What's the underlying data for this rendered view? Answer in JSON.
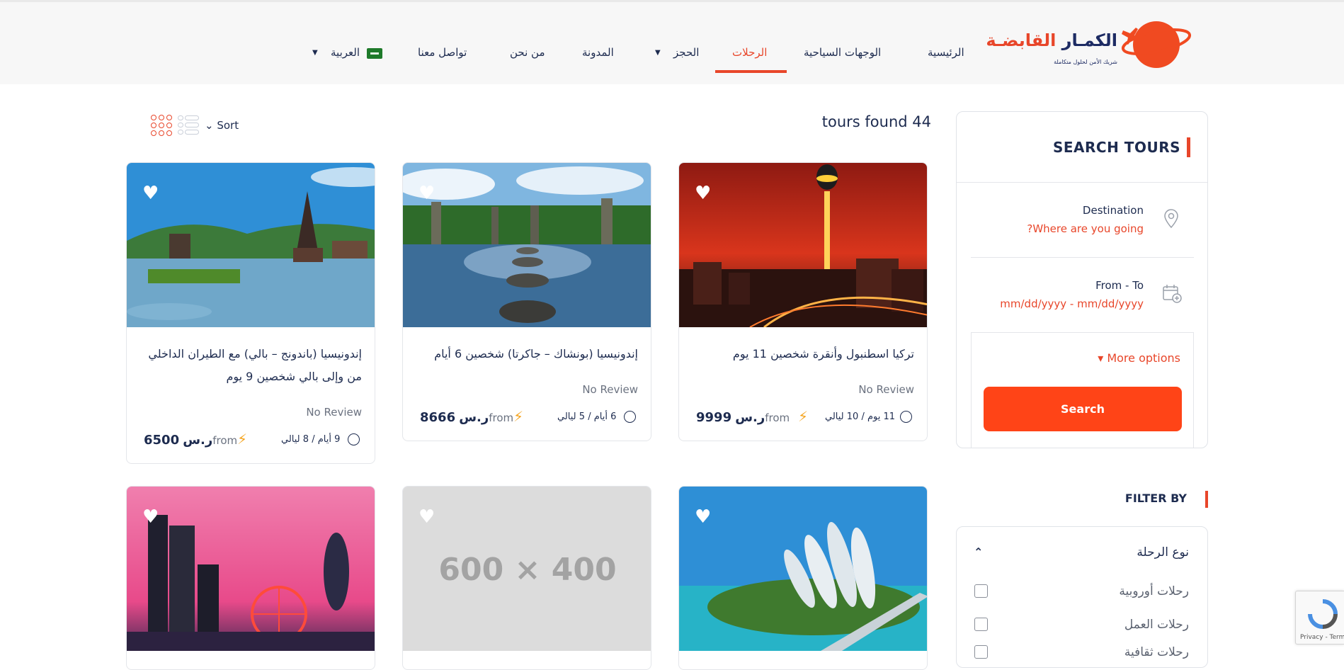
{
  "header": {
    "logo": {
      "name_navy": "الكمـار",
      "name_orange": "القابضـة",
      "tagline": "شريك الأمن لحلول متكاملة"
    },
    "nav": [
      {
        "label": "الرئيسية"
      },
      {
        "label": "الوجهات السياحية"
      },
      {
        "label": "الرحلات"
      },
      {
        "label": "الحجز"
      },
      {
        "label": "المدونة"
      },
      {
        "label": "من نحن"
      },
      {
        "label": "تواصل معنا"
      },
      {
        "label": "العربية"
      }
    ],
    "active_nav": "الرحلات"
  },
  "results": {
    "count_text": "tours found 44",
    "sort_label": "Sort"
  },
  "tours": [
    {
      "title": "تركيا اسطنبول وأنقرة شخصين 11 يوم",
      "review": "No Review",
      "duration": "11 يوم / 10 ليالي",
      "from": "from",
      "price": "9999",
      "currency": "ر.س",
      "image": "istanbul-night"
    },
    {
      "title": "إندونيسيا (بونشاك – جاكرتا) شخصين 6 أيام",
      "review": "No Review",
      "duration": "6 أيام / 5 ليالي",
      "from": "from",
      "price": "8666",
      "currency": "ر.س",
      "image": "bali-water-temple"
    },
    {
      "title": "إندونيسيا (باندونج – بالي) مع الطيران الداخلي من وإلى بالي شخصين 9 يوم",
      "review": "No Review",
      "duration": "9 أيام / 8 ليالي",
      "from": "from",
      "price": "6500",
      "currency": "ر.س",
      "image": "bali-lake-temple"
    },
    {
      "image": "island-resort"
    },
    {
      "image": "placeholder",
      "placeholder_text": "600 × 400"
    },
    {
      "image": "city-skyline-sunset"
    }
  ],
  "search": {
    "title": "SEARCH TOURS",
    "destination_label": "Destination",
    "destination_placeholder": "?Where are you going",
    "dates_label": "From - To",
    "dates_placeholder": "mm/dd/yyyy - mm/dd/yyyy",
    "more_options": "More options",
    "button": "Search"
  },
  "filter": {
    "title": "FILTER BY",
    "group_title": "نوع الرحلة",
    "options": [
      {
        "label": "رحلات أوروبية",
        "checked": false
      },
      {
        "label": "رحلات العمل",
        "checked": false
      },
      {
        "label": "رحلات ثقافية",
        "checked": false
      }
    ]
  },
  "recaptcha": {
    "text": "Privacy - Terms"
  },
  "colors": {
    "accent": "#e8462a",
    "button": "#ff4417",
    "navy": "#1d2b4f",
    "header_bg": "#f7f7f7"
  }
}
